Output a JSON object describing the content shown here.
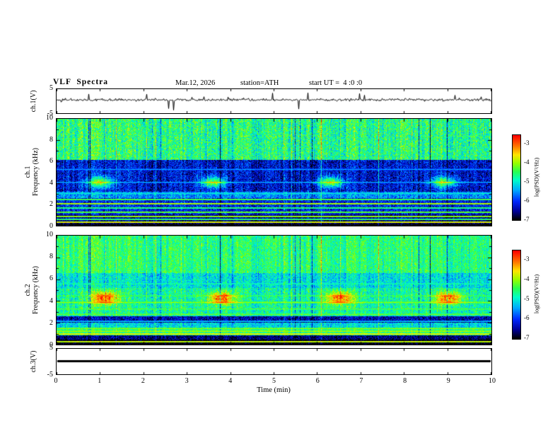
{
  "title": {
    "main": "VLF  Spectra",
    "date": "Mar.12, 2026",
    "station": "station=ATH",
    "start_ut": "start UT =  4 :0 :0"
  },
  "x_axis": {
    "label": "Time (min)",
    "min": 0,
    "max": 10,
    "ticks": [
      "0",
      "1",
      "2",
      "3",
      "4",
      "5",
      "6",
      "7",
      "8",
      "9",
      "10"
    ]
  },
  "colorbar": {
    "label": "log(PSD)(V²/Hz)",
    "ticks": [
      "-3",
      "-4",
      "-5",
      "-6",
      "-7"
    ],
    "value_top": -3,
    "value_bottom": -7
  },
  "chart_data": [
    {
      "type": "line",
      "panel": "ch1-waveform",
      "ylabel": "ch.1(V)",
      "ylim": [
        -5,
        5
      ],
      "yticks": [
        {
          "v": 5,
          "label": "5"
        },
        {
          "v": -5,
          "label": "-5"
        }
      ],
      "description": "Broadband noisy voltage trace centered near +0.5 V with dense impulsive spikes reaching about ±4 V"
    },
    {
      "type": "heatmap",
      "panel": "ch1-spectrogram",
      "ylabel_line1": "ch.1",
      "ylabel_line2": "Frequency (kHz)",
      "ylim_khz": [
        0,
        10
      ],
      "yticks": [
        {
          "v": 10,
          "label": "10"
        },
        {
          "v": 8,
          "label": "8"
        },
        {
          "v": 6,
          "label": "6"
        },
        {
          "v": 4,
          "label": "4"
        },
        {
          "v": 2,
          "label": "2"
        },
        {
          "v": 0,
          "label": "0"
        }
      ],
      "zlabel": "log(PSD)(V²/Hz)",
      "zlim": [
        -7,
        -3
      ],
      "features": {
        "bright_band_khz": [
          6.2,
          10
        ],
        "dark_band_khz": [
          3.2,
          6.2
        ],
        "hum_lines": [
          [
            0.35,
            -3.8
          ],
          [
            0.6,
            -4.6
          ],
          [
            0.9,
            -4.1
          ],
          [
            1.3,
            -4.3
          ],
          [
            1.7,
            -4.6
          ],
          [
            2.1,
            -4.0
          ],
          [
            2.5,
            -4.4
          ],
          [
            3.05,
            -5.2
          ],
          [
            4.1,
            -5.5
          ],
          [
            5.3,
            -5.6
          ]
        ],
        "blobs": {
          "times_min": [
            1.0,
            3.6,
            6.3,
            8.9
          ],
          "freq_khz": 4.1,
          "amp_db": 1.9,
          "dt_min": 0.28,
          "df_khz": 0.55
        },
        "vertical_dropouts": "frequent narrow dark columns and sporadic bright red columns across all frequencies"
      }
    },
    {
      "type": "heatmap",
      "panel": "ch2-spectrogram",
      "ylabel_line1": "ch.2",
      "ylabel_line2": "Frequency (kHz)",
      "ylim_khz": [
        0,
        10
      ],
      "yticks": [
        {
          "v": 10,
          "label": "10"
        },
        {
          "v": 8,
          "label": "8"
        },
        {
          "v": 6,
          "label": "6"
        },
        {
          "v": 4,
          "label": "4"
        },
        {
          "v": 2,
          "label": "2"
        },
        {
          "v": 0,
          "label": "0"
        }
      ],
      "zlabel": "log(PSD)(V²/Hz)",
      "zlim": [
        -7,
        -3
      ],
      "features": {
        "bright_band_khz": [
          0.9,
          1.6
        ],
        "dark_band_khz": [
          2.05,
          2.6
        ],
        "hum_lines": [
          [
            0.3,
            -3.9
          ],
          [
            1.0,
            -3.8
          ],
          [
            1.25,
            -4.1
          ],
          [
            1.5,
            -4.3
          ],
          [
            2.15,
            -5.3
          ],
          [
            2.8,
            -4.4
          ],
          [
            3.3,
            -4.5
          ],
          [
            3.9,
            -4.3
          ],
          [
            4.5,
            -4.6
          ],
          [
            5.6,
            -4.9
          ]
        ],
        "blobs": {
          "times_min": [
            1.1,
            3.8,
            6.5,
            9.0
          ],
          "freq_khz": 4.3,
          "amp_db": 1.7,
          "dt_min": 0.3,
          "df_khz": 0.6
        },
        "vertical_dropouts": "narrow dark columns aligned with ch.1 dropouts"
      }
    },
    {
      "type": "line",
      "panel": "ch3-waveform",
      "ylabel": "ch.3(V)",
      "ylim": [
        -5,
        5
      ],
      "yticks": [
        {
          "v": 5,
          "label": "5"
        },
        {
          "v": -5,
          "label": "-5"
        }
      ],
      "description": "Constant 0 V — flat heavy black line across the full record"
    }
  ]
}
